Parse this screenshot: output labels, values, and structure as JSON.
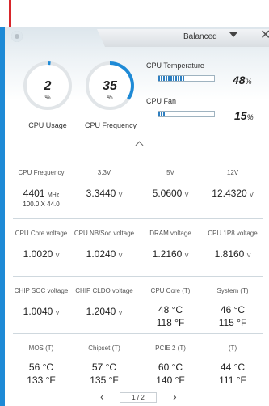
{
  "toolbar": {
    "profile": "Balanced"
  },
  "gauges": {
    "cpu_usage": {
      "value": "2",
      "unit": "%",
      "label": "CPU Usage",
      "percent": 2
    },
    "cpu_frequency": {
      "value": "35",
      "unit": "%",
      "label": "CPU Frequency",
      "percent": 35
    }
  },
  "bars": {
    "cpu_temperature": {
      "label": "CPU Temperature",
      "value": "48",
      "unit": "%",
      "percent": 48
    },
    "cpu_fan": {
      "label": "CPU Fan",
      "value": "15",
      "unit": "%",
      "percent": 15
    }
  },
  "grid": [
    [
      {
        "label": "CPU Frequency",
        "value": "4401",
        "unit": "MHz",
        "sub": "100.0 X 44.0"
      },
      {
        "label": "3.3V",
        "value": "3.3440",
        "unit": "V"
      },
      {
        "label": "5V",
        "value": "5.0600",
        "unit": "V"
      },
      {
        "label": "12V",
        "value": "12.4320",
        "unit": "V"
      }
    ],
    [
      {
        "label": "CPU Core voltage",
        "value": "1.0020",
        "unit": "V"
      },
      {
        "label": "CPU NB/Soc voltage",
        "value": "1.0240",
        "unit": "V"
      },
      {
        "label": "DRAM voltage",
        "value": "1.2160",
        "unit": "V"
      },
      {
        "label": "CPU 1P8 voltage",
        "value": "1.8160",
        "unit": "V"
      }
    ],
    [
      {
        "label": "CHIP SOC voltage",
        "value": "1.0040",
        "unit": "V"
      },
      {
        "label": "CHIP CLDO voltage",
        "value": "1.2040",
        "unit": "V"
      },
      {
        "label": "CPU Core (T)",
        "value": "48 °C",
        "value2": "118 °F"
      },
      {
        "label": "System (T)",
        "value": "46 °C",
        "value2": "115 °F"
      }
    ],
    [
      {
        "label": "MOS (T)",
        "value": "56 °C",
        "value2": "133 °F"
      },
      {
        "label": "Chipset (T)",
        "value": "57 °C",
        "value2": "135 °F"
      },
      {
        "label": "PCIE 2 (T)",
        "value": "60 °C",
        "value2": "140 °F"
      },
      {
        "label": "(T)",
        "value": "44 °C",
        "value2": "111 °F"
      }
    ]
  ],
  "pager": {
    "current": "1",
    "total": "2",
    "separator": "/"
  },
  "icons": {
    "settings": "gear-icon",
    "close": "close-icon",
    "dropdown": "chevron-down-icon",
    "collapse": "chevron-up-icon"
  },
  "colors": {
    "accent": "#1e8ad6",
    "marker": "#d8262b"
  }
}
